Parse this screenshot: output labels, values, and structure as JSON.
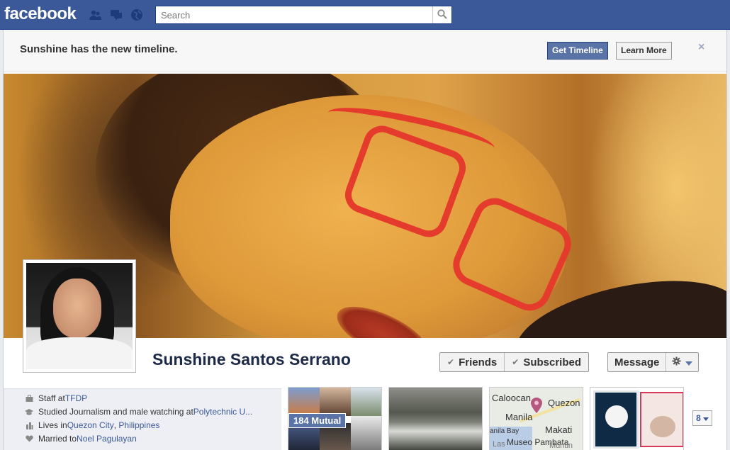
{
  "topbar": {
    "logo": "facebook",
    "search_placeholder": "Search"
  },
  "banner": {
    "text": "Sunshine has the new timeline.",
    "primary_button": "Get Timeline",
    "secondary_button": "Learn More",
    "close": "×"
  },
  "profile": {
    "name": "Sunshine Santos Serrano",
    "buttons": {
      "friends": "Friends",
      "subscribed": "Subscribed",
      "message": "Message",
      "check": "✔"
    },
    "info": {
      "work_prefix": "Staff at ",
      "work_link": "TFDP",
      "study_prefix": "Studied Journalism and male watching at ",
      "study_link": "Polytechnic U...",
      "lives_prefix": "Lives in ",
      "lives_city": "Quezon City",
      "lives_sep": ", ",
      "lives_country": "Philippines",
      "married_prefix": "Married to ",
      "married_link": "Noel Pagulayan"
    }
  },
  "tiles": {
    "friends_mutual": "184 Mutual",
    "map_labels": [
      "Caloocan",
      "Quezon",
      "Manila",
      "Makati",
      "anila Bay",
      "Museo Pambata",
      "Las",
      "Muntin"
    ],
    "more_count": "8"
  },
  "colors": {
    "brand_blue": "#3b5998",
    "link_blue": "#3b5998",
    "button_blue": "#5b74a8"
  },
  "icons": [
    "friends-jewel-icon",
    "messages-jewel-icon",
    "notifications-globe-icon",
    "search-icon",
    "briefcase-icon",
    "graduation-icon",
    "home-icon",
    "heart-icon",
    "gear-icon",
    "chevron-down-icon",
    "map-pin-icon"
  ]
}
